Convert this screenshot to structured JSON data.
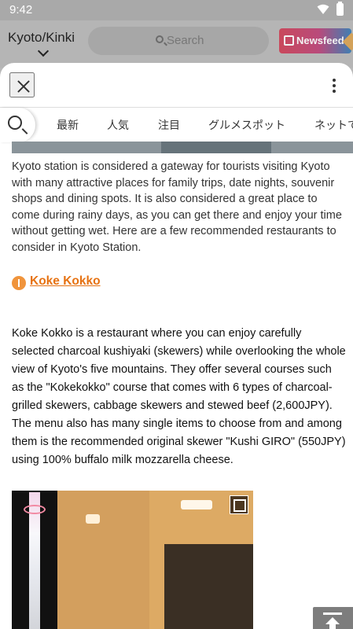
{
  "status_bar": {
    "time": "9:42",
    "icons": [
      "wifi-icon",
      "battery-icon"
    ]
  },
  "background_app": {
    "region": "Kyoto/Kinki",
    "search_placeholder": "Search",
    "newsfeed_label": "Newsfeed",
    "newsfeed_color": "#c9495c"
  },
  "sheet": {
    "close_icon": "close-icon",
    "more_icon": "more-vert-icon",
    "tabs": [
      "最新",
      "人気",
      "注目",
      "グルメスポット",
      "ネットで"
    ]
  },
  "article": {
    "intro": "Kyoto station is considered a gateway for tourists visiting Kyoto with many attractive places for family trips, date nights, souvenir shops and dining spots. It is also considered a great place to come during rainy days, as you can get there and enjoy your time without getting wet. Here are a few recommended restaurants to consider in Kyoto Station.",
    "restaurant_name": "Koke Kokko",
    "restaurant_color": "#e67212",
    "description": "Koke Kokko is a restaurant where you can enjoy carefully selected charcoal kushiyaki (skewers) while overlooking the whole view of Kyoto's five mountains. They offer several courses such as the  \"Kokekokko\" course that comes with 6 types of charcoal-grilled skewers, cabbage skewers and stewed beef (2,600JPY). The menu also has many single items to choose from and among them is the recommended original skewer \"Kushi GIRO\" (550JPY) using 100% buffalo milk mozzarella cheese."
  },
  "controls": {
    "expand_icon": "expand-icon",
    "scroll_top_icon": "scroll-to-top-icon"
  }
}
